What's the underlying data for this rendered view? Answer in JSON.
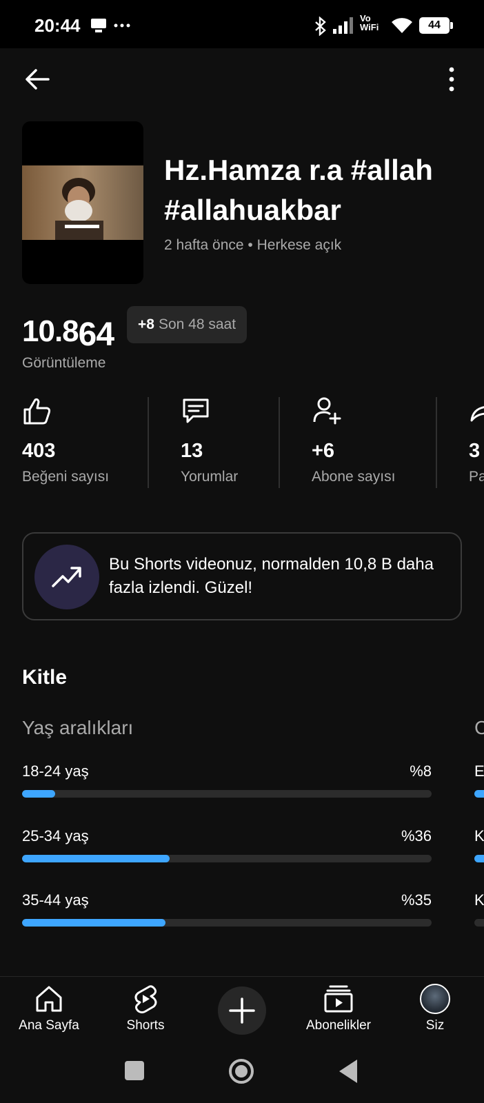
{
  "status_bar": {
    "time": "20:44",
    "icons": [
      "cast-icon",
      "more-dots-icon",
      "bluetooth-icon",
      "signal-icon",
      "vowifi-icon",
      "wifi-icon",
      "battery-icon"
    ],
    "vowifi_text_1": "Vo",
    "vowifi_text_2": "WiFi",
    "battery": "44"
  },
  "video": {
    "title": "Hz.Hamza r.a #allah #allahuakbar",
    "meta": "2 hafta önce • Herkese açık"
  },
  "views": {
    "value_main": "10.8",
    "value_tail": "64",
    "label": "Görüntüleme",
    "delta": "+8",
    "delta_label": "Son 48 saat"
  },
  "metrics": [
    {
      "icon": "thumbs-up-icon",
      "value": "403",
      "label": "Beğeni sayısı"
    },
    {
      "icon": "comment-icon",
      "value": "13",
      "label": "Yorumlar"
    },
    {
      "icon": "add-person-icon",
      "value": "+6",
      "label": "Abone sayısı"
    },
    {
      "icon": "share-icon",
      "value": "3",
      "label": "Pa"
    }
  ],
  "insight": {
    "icon": "trending-up-icon",
    "text": "Bu Shorts videonuz, normalden 10,8 B daha fazla izlendi. Güzel!"
  },
  "audience": {
    "title": "Kitle",
    "age_title": "Yaş aralıkları",
    "next_title_peek": "C",
    "age_groups": [
      {
        "label": "18-24 yaş",
        "percent_text": "%8",
        "fraction": 0.08
      },
      {
        "label": "25-34 yaş",
        "percent_text": "%36",
        "fraction": 0.36
      },
      {
        "label": "35-44 yaş",
        "percent_text": "%35",
        "fraction": 0.35
      }
    ],
    "next_peek_labels": [
      "E",
      "K",
      "K"
    ]
  },
  "bottom_nav": [
    {
      "icon": "home-icon",
      "label": "Ana Sayfa"
    },
    {
      "icon": "shorts-icon",
      "label": "Shorts"
    },
    {
      "icon": "plus-icon",
      "label": ""
    },
    {
      "icon": "subscriptions-icon",
      "label": "Abonelikler"
    },
    {
      "icon": "avatar",
      "label": "Siz"
    }
  ],
  "accent_color": "#3ea6ff"
}
